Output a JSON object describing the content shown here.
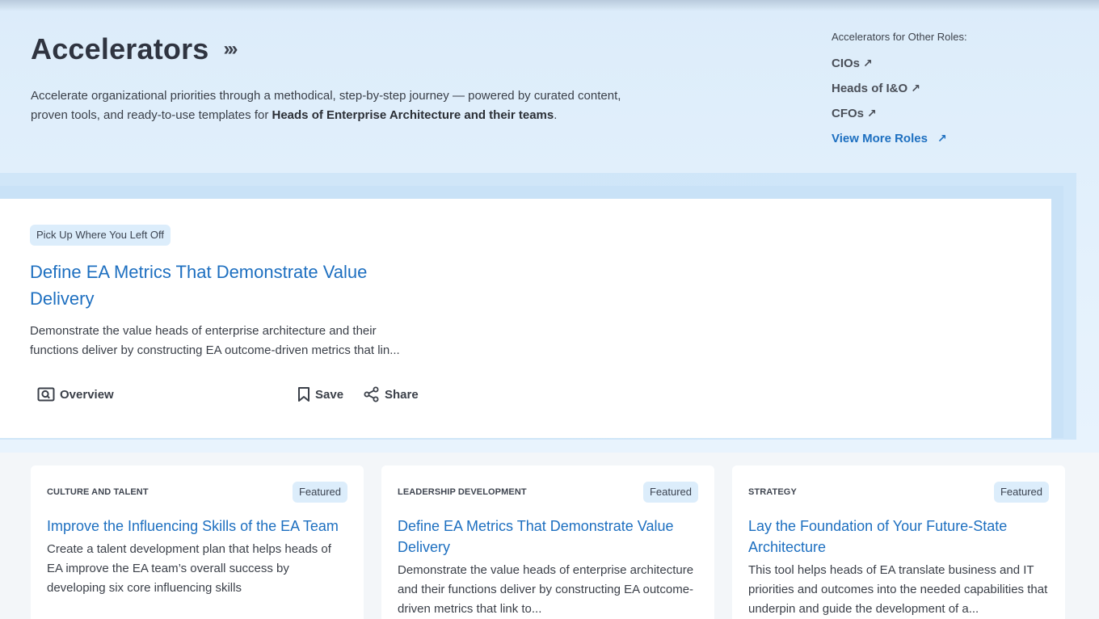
{
  "header": {
    "title": "Accelerators",
    "title_chevrons": "›››",
    "intro_text": "Accelerate organizational priorities through a methodical, step-by-step journey — powered by curated content, proven tools, and ready-to-use templates for ",
    "intro_bold": "Heads of Enterprise Architecture and their teams",
    "intro_end": "."
  },
  "other_roles": {
    "heading": "Accelerators for Other Roles:",
    "links": [
      {
        "label": "CIOs"
      },
      {
        "label": "Heads of I&O"
      },
      {
        "label": "CFOs"
      }
    ],
    "view_more": "View More Roles"
  },
  "resume": {
    "pill": "Pick Up Where You Left Off",
    "title": "Define EA Metrics That Demonstrate Value Delivery",
    "description": "Demonstrate the value heads of enterprise architecture and their functions deliver by constructing EA outcome-driven metrics that lin...",
    "actions": {
      "overview": "Overview",
      "save": "Save",
      "share": "Share"
    }
  },
  "cards": [
    {
      "category": "CULTURE AND TALENT",
      "badge": "Featured",
      "title": "Improve the Influencing Skills of the EA Team",
      "description": "Create a talent development plan that helps heads of EA improve the EA team’s overall success by developing six core influencing skills"
    },
    {
      "category": "LEADERSHIP DEVELOPMENT",
      "badge": "Featured",
      "title": "Define EA Metrics That Demonstrate Value Delivery",
      "description": "Demonstrate the value heads of enterprise architecture and their functions deliver by constructing EA outcome-driven metrics that link to..."
    },
    {
      "category": "STRATEGY",
      "badge": "Featured",
      "title": "Lay the Foundation of Your Future-State Architecture",
      "description": "This tool helps heads of EA translate business and IT priorities and outcomes into the needed capabilities that underpin and guide the development of a..."
    }
  ],
  "colors": {
    "accent": "#1d6fc0",
    "pill_bg": "#dcedfb",
    "hero_bg": "#dcecfa"
  },
  "icons": [
    "chevrons-right-icon",
    "arrow-up-right-icon",
    "overview-icon",
    "bookmark-icon",
    "share-icon"
  ]
}
